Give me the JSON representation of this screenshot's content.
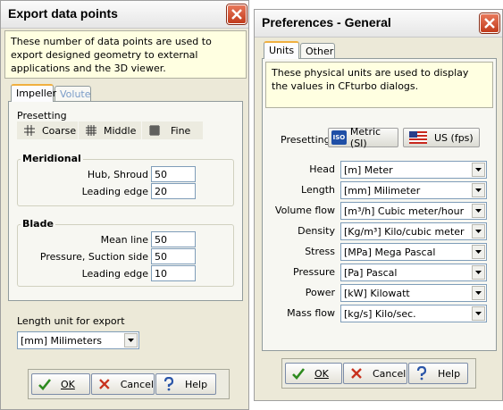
{
  "export_dialog": {
    "title": "Export data points",
    "info": "These number of data points are used to export designed geometry to external applications and the 3D viewer.",
    "tabs": [
      "Impeller",
      "Volute"
    ],
    "presetting_label": "Presetting",
    "preset_buttons": [
      "Coarse",
      "Middle",
      "Fine"
    ],
    "meridional": {
      "title": "Meridional",
      "rows": [
        {
          "label": "Hub, Shroud",
          "value": "50"
        },
        {
          "label": "Leading edge",
          "value": "20"
        }
      ]
    },
    "blade": {
      "title": "Blade",
      "rows": [
        {
          "label": "Mean line",
          "value": "50"
        },
        {
          "label": "Pressure, Suction side",
          "value": "50"
        },
        {
          "label": "Leading edge",
          "value": "10"
        }
      ]
    },
    "length_unit_label": "Length unit for export",
    "length_unit_value": "[mm] Milimeters",
    "buttons": {
      "ok": "OK",
      "cancel": "Cancel",
      "help": "Help"
    }
  },
  "prefs_dialog": {
    "title": "Preferences - General",
    "tabs": [
      "Units",
      "Other"
    ],
    "info": "These physical units are used to display the values in CFturbo dialogs.",
    "presetting_label": "Presetting",
    "preset_metric": "Metric (SI)",
    "preset_us": "US (fps)",
    "iso_badge": "ISO",
    "units": [
      {
        "label": "Head",
        "value": "[m] Meter"
      },
      {
        "label": "Length",
        "value": "[mm] Milimeter"
      },
      {
        "label": "Volume flow",
        "value": "[m³/h] Cubic meter/hour"
      },
      {
        "label": "Density",
        "value": "[Kg/m³] Kilo/cubic meter"
      },
      {
        "label": "Stress",
        "value": "[MPa] Mega Pascal"
      },
      {
        "label": "Pressure",
        "value": "[Pa] Pascal"
      },
      {
        "label": "Power",
        "value": "[kW] Kilowatt"
      },
      {
        "label": "Mass flow",
        "value": "[kg/s] Kilo/sec."
      }
    ],
    "buttons": {
      "ok": "OK",
      "cancel": "Cancel",
      "help": "Help"
    }
  },
  "colors": {
    "info_bg": "#ffffe1",
    "dialog_bg": "#ece9d8",
    "close_red": "#d2502e",
    "tab_accent": "#f0b040"
  }
}
